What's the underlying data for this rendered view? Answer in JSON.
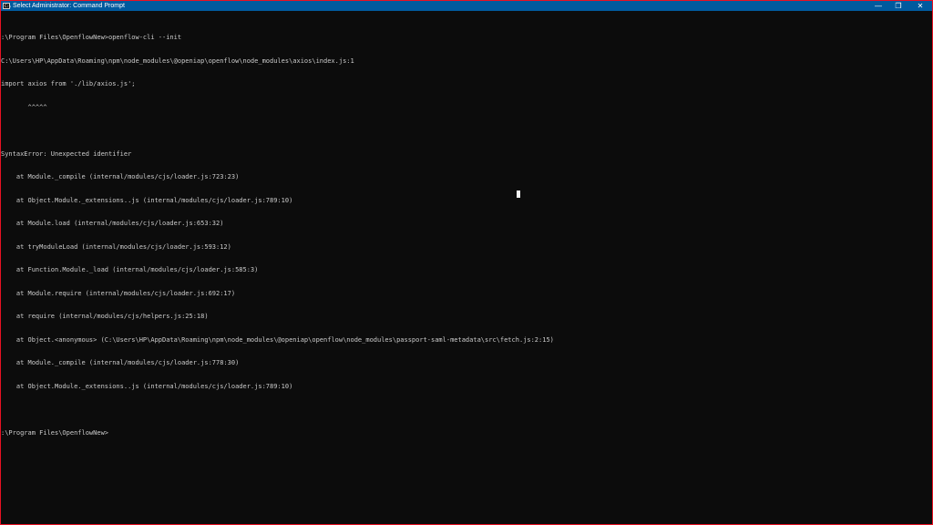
{
  "window": {
    "title": "Select Administrator: Command Prompt",
    "icon": "command-prompt-icon",
    "icon_label": "C:\\",
    "minimize_glyph": "—",
    "maximize_glyph": "❐",
    "close_glyph": "✕"
  },
  "console": {
    "lines": [
      ":\\Program Files\\OpenflowNew>openflow-cli --init",
      "C:\\Users\\HP\\AppData\\Roaming\\npm\\node_modules\\@openiap\\openflow\\node_modules\\axios\\index.js:1",
      "import axios from './lib/axios.js';",
      "       ^^^^^",
      "",
      "SyntaxError: Unexpected identifier",
      "    at Module._compile (internal/modules/cjs/loader.js:723:23)",
      "    at Object.Module._extensions..js (internal/modules/cjs/loader.js:789:10)",
      "    at Module.load (internal/modules/cjs/loader.js:653:32)",
      "    at tryModuleLoad (internal/modules/cjs/loader.js:593:12)",
      "    at Function.Module._load (internal/modules/cjs/loader.js:585:3)",
      "    at Module.require (internal/modules/cjs/loader.js:692:17)",
      "    at require (internal/modules/cjs/helpers.js:25:18)",
      "    at Object.<anonymous> (C:\\Users\\HP\\AppData\\Roaming\\npm\\node_modules\\@openiap\\openflow\\node_modules\\passport-saml-metadata\\src\\fetch.js:2:15)",
      "    at Module._compile (internal/modules/cjs/loader.js:778:30)",
      "    at Object.Module._extensions..js (internal/modules/cjs/loader.js:789:10)",
      "",
      ":\\Program Files\\OpenflowNew>"
    ]
  },
  "colors": {
    "titlebar": "#005a9e",
    "console_bg": "#0c0c0c",
    "console_text": "#cccccc",
    "window_border": "#e81123"
  }
}
